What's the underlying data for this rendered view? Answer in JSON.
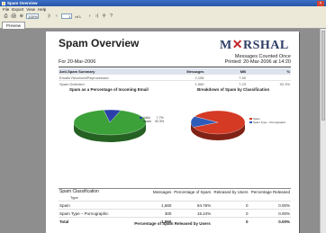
{
  "window": {
    "title": "Spam Overview",
    "close_glyph": "×"
  },
  "menu": [
    "File",
    "Export",
    "View",
    "Help"
  ],
  "toolbar": {
    "zoom_value": "100%",
    "page_current": "1",
    "page_total_label": "of 1",
    "icons": [
      "print-icon",
      "print-setup-icon",
      "zoom-icon",
      "first-page-icon",
      "prev-page-icon",
      "next-page-icon",
      "last-page-icon",
      "binoculars-icon",
      "help-icon"
    ]
  },
  "tab": {
    "label": "Preview"
  },
  "report": {
    "title": "Spam Overview",
    "logo_left": "M",
    "logo_mark": "✕",
    "logo_right": "RSHAL",
    "date_label": "For 20-Mar-2006",
    "counted_label": "Messages Counted Once",
    "printed_label": "Printed: 20-Mar-2006 at 14:20",
    "summary": {
      "headers": [
        "Anti-Spam Summary",
        "Messages",
        "MB",
        "%"
      ],
      "rows": [
        [
          "Emails Received/Reprocessed",
          "2,155",
          "7.59",
          ""
        ],
        [
          "Spam Detected",
          "1,960",
          "7.23",
          "92.3%"
        ]
      ]
    },
    "chart1_title": "Spam as a Percentage of Incoming Email",
    "chart2_title": "Breakdown of Spam by Classification",
    "classification": {
      "headers": [
        "Spam Classification",
        "Messages",
        "Percentage of Spam",
        "Released by Users",
        "Percentage Released"
      ],
      "subheader": "Type",
      "rows": [
        [
          "Spam",
          "1,660",
          "84.76%",
          "0",
          "0.00%"
        ],
        [
          "Spam Type – Pornographic",
          "300",
          "15.24%",
          "0",
          "0.00%"
        ],
        [
          "Total",
          "1,960",
          "",
          "0",
          "0.00%"
        ]
      ]
    },
    "footer_title": "Percentage of Spam Released by Users"
  },
  "chart_data": [
    {
      "type": "pie",
      "title": "Spam as a Percentage of Incoming Email",
      "categories": [
        "Valid",
        "Spam"
      ],
      "values": [
        7.7,
        92.3
      ],
      "value_labels": [
        "7.7%",
        "92.3%"
      ],
      "colors": [
        "#2a3fa8",
        "#3da13a"
      ],
      "legend": "right"
    },
    {
      "type": "pie",
      "title": "Breakdown of Spam by Classification",
      "categories": [
        "Spam",
        "Spam Type – Pornographic"
      ],
      "values": [
        84.76,
        15.24
      ],
      "colors": [
        "#d53a24",
        "#2f5cb8"
      ],
      "legend": "right"
    }
  ]
}
